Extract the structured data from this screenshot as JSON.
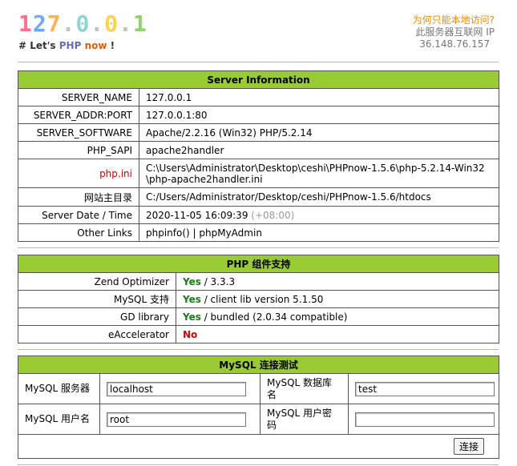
{
  "header": {
    "logo_chars": [
      "1",
      "2",
      "7",
      ".",
      "0",
      ".",
      "0",
      ".",
      "1"
    ],
    "logo_colors": [
      "#ff6f8e",
      "#6fa8ff",
      "#ffb14d",
      "#c2c2c2",
      "#8fd4d4",
      "#c2c2c2",
      "#ffd24d",
      "#c2c2c2",
      "#8ed46a"
    ],
    "tagline_prefix": "# Let's ",
    "tagline_php": "PHP",
    "tagline_now": "now",
    "tagline_suffix": " !",
    "side_link": "为何只能本地访问?",
    "side_text": "此服务器互联网 IP",
    "side_ip": "36.148.76.157"
  },
  "server": {
    "title": "Server Information",
    "rows": [
      {
        "key": "SERVER_NAME",
        "value": "127.0.0.1"
      },
      {
        "key": "SERVER_ADDR:PORT",
        "value": "127.0.0.1:80"
      },
      {
        "key": "SERVER_SOFTWARE",
        "value": "Apache/2.2.16 (Win32) PHP/5.2.14"
      },
      {
        "key": "PHP_SAPI",
        "value": "apache2handler"
      },
      {
        "key": "php.ini",
        "value": "C:\\Users\\Administrator\\Desktop\\ceshi\\PHPnow-1.5.6\\php-5.2.14-Win32\\php-apache2handler.ini"
      },
      {
        "key": "网站主目录",
        "value": "C:/Users/Administrator/Desktop/ceshi/PHPnow-1.5.6/htdocs"
      },
      {
        "key": "Server Date / Time",
        "value": "2020-11-05 16:09:39",
        "tz": "(+08:00)"
      },
      {
        "key": "Other Links",
        "link1": "phpinfo()",
        "sep": " | ",
        "link2": "phpMyAdmin"
      }
    ]
  },
  "components": {
    "title": "PHP 组件支持",
    "rows": [
      {
        "key": "Zend Optimizer",
        "status": "Yes",
        "detail": " / 3.3.3"
      },
      {
        "key": "MySQL 支持",
        "status": "Yes",
        "detail": " / client lib version 5.1.50"
      },
      {
        "key": "GD library",
        "status": "Yes",
        "detail": " / bundled (2.0.34 compatible)"
      },
      {
        "key": "eAccelerator",
        "status": "No",
        "detail": ""
      }
    ]
  },
  "mysql": {
    "title": "MySQL 连接测试",
    "host_label": "MySQL 服务器",
    "host_value": "localhost",
    "db_label": "MySQL 数据库名",
    "db_value": "test",
    "user_label": "MySQL 用户名",
    "user_value": "root",
    "pass_label": "MySQL 用户密码",
    "pass_value": "",
    "connect_label": "连接"
  }
}
